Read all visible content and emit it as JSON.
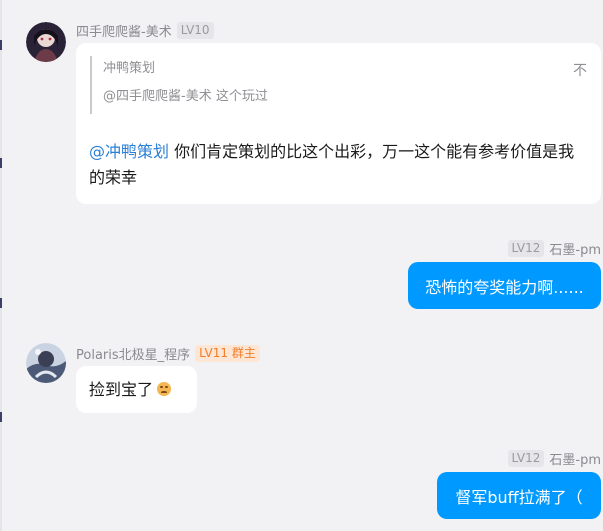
{
  "messages": [
    {
      "sender": "四手爬爬酱-美术",
      "level": "LV10",
      "quote": {
        "author": "冲鸭策划",
        "text": "@四手爬爬酱-美术 这个玩过",
        "close": "不"
      },
      "mention": "@冲鸭策划",
      "text": " 你们肯定策划的比这个出彩，万一这个能有参考价值是我的荣幸"
    },
    {
      "level": "LV12",
      "sender": "石墨-pm",
      "text": "恐怖的夸奖能力啊......"
    },
    {
      "sender": "Polaris北极星_程序",
      "level": "LV11",
      "role": "群主",
      "text": "捡到宝了",
      "emoji": "sad-face-emoji"
    },
    {
      "level": "LV12",
      "sender": "石墨-pm",
      "text": "督军buff拉满了（"
    }
  ],
  "colors": {
    "background": "#f2f2f5",
    "bubble_self": "#0099ff",
    "bubble_other": "#ffffff",
    "mention": "#2b7fd6",
    "owner_badge": "#f07d2c"
  }
}
